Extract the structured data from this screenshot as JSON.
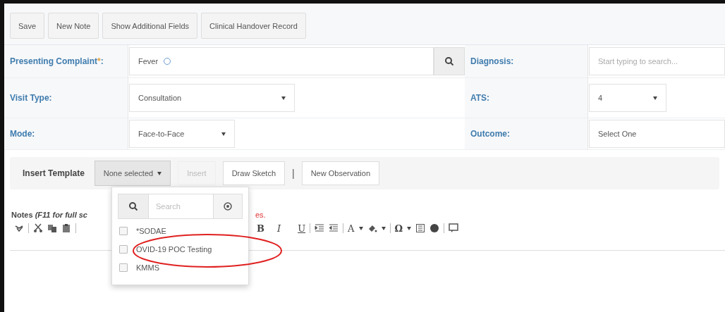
{
  "toolbar": {
    "buttons": [
      "Save",
      "New Note",
      "Show Additional Fields",
      "Clinical Handover Record"
    ]
  },
  "form": {
    "presenting_complaint": {
      "label": "Presenting Complaint",
      "required_mark": "*",
      "suffix": ":",
      "value": "Fever"
    },
    "diagnosis": {
      "label": "Diagnosis:",
      "placeholder": "Start typing to search..."
    },
    "visit_type": {
      "label": "Visit Type:",
      "value": "Consultation"
    },
    "ats": {
      "label": "ATS:",
      "value": "4"
    },
    "mode": {
      "label": "Mode:",
      "value": "Face-to-Face"
    },
    "outcome": {
      "label": "Outcome:",
      "value": "Select One"
    }
  },
  "template_bar": {
    "label": "Insert Template",
    "dropdown": "None selected",
    "insert": {
      "label": "Insert",
      "disabled": true
    },
    "draw_sketch": "Draw Sketch",
    "divider": "|",
    "new_observation": "New Observation"
  },
  "template_menu": {
    "search_placeholder": "Search",
    "options": [
      {
        "label": "*SODAE",
        "checked": false
      },
      {
        "label": "OVID-19 POC Testing",
        "checked": false
      },
      {
        "label": "KMMS",
        "checked": false
      }
    ]
  },
  "notes": {
    "label": "Notes *(F11 for full sc*",
    "hint_tail": "es."
  },
  "editor_toolbar": {
    "glyphs": [
      "B",
      "I",
      "U",
      "A",
      "Ω"
    ]
  }
}
